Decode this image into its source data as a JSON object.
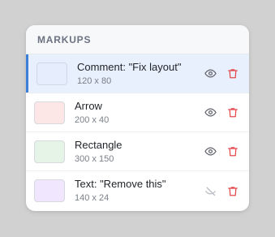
{
  "panel": {
    "title": "MARKUPS"
  },
  "colors": {
    "accent": "#3b7fd9",
    "selected_bg": "#e8effd",
    "delete": "#e5484d",
    "eye": "#5f6368",
    "hidden_eye": "#b8bcc2"
  },
  "markups": [
    {
      "name": "Comment: \"Fix layout\"",
      "dims": "120 x 80",
      "swatch": "#e6edfc",
      "selected": true,
      "visible": true,
      "visibility_icon": "eye-icon",
      "delete_icon": "trash-icon"
    },
    {
      "name": "Arrow",
      "dims": "200 x 40",
      "swatch": "#fde7e6",
      "selected": false,
      "visible": true,
      "visibility_icon": "eye-icon",
      "delete_icon": "trash-icon"
    },
    {
      "name": "Rectangle",
      "dims": "300 x 150",
      "swatch": "#e5f4e7",
      "selected": false,
      "visible": true,
      "visibility_icon": "eye-icon",
      "delete_icon": "trash-icon"
    },
    {
      "name": "Text: \"Remove this\"",
      "dims": "140 x 24",
      "swatch": "#f0e6fd",
      "selected": false,
      "visible": false,
      "visibility_icon": "eye-off-icon",
      "delete_icon": "trash-icon"
    }
  ]
}
